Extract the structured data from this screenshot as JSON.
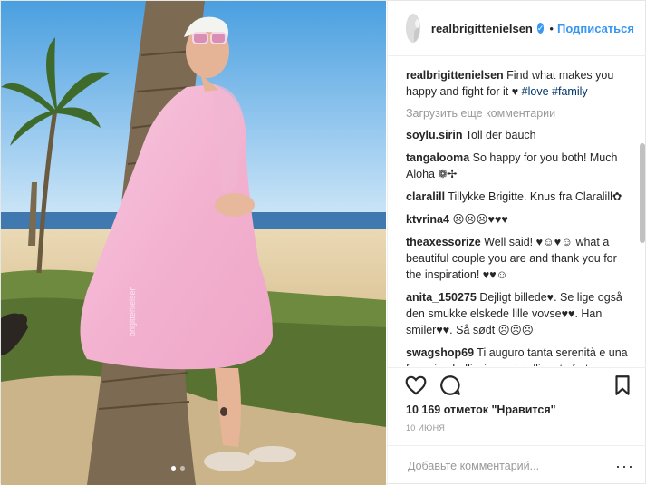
{
  "colors": {
    "link": "#3897f0",
    "hashtag": "#003569",
    "muted": "#999999",
    "text": "#262626"
  },
  "photo": {
    "watermark": "brigittenielsen",
    "carousel_dots": 2,
    "active_dot": 1
  },
  "header": {
    "username": "realbrigittenielsen",
    "verified_icon": "check-icon",
    "separator": "•",
    "follow_label": "Подписаться"
  },
  "caption": {
    "username": "realbrigittenielsen",
    "text": "Find what makes you happy and fight for it ♥",
    "hashtags": [
      "#love",
      "#family"
    ]
  },
  "load_more": "Загрузить еще комментарии",
  "comments": [
    {
      "user": "soylu.sirin",
      "text": "Toll der bauch"
    },
    {
      "user": "tangalooma",
      "text": "So happy for you both! Much Aloha ❁✢"
    },
    {
      "user": "claralill",
      "text": "Tillykke Brigitte. Knus fra Claralill✿"
    },
    {
      "user": "ktvrina4",
      "text": "☹☹☹♥♥♥"
    },
    {
      "user": "theaxessorize",
      "text": "Well said! ♥☺♥☺ what a beautiful couple you are and thank you for the inspiration! ♥♥☺"
    },
    {
      "user": "anita_150275",
      "text": "Dejligt billede♥. Se lige også den smukke elskede lille vovse♥♥. Han smiler♥♥. Så sødt ☹☹☹"
    },
    {
      "user": "swagshop69",
      "text": "Ti auguro tanta serenità e una femmina bellissima e intelligente forte come te,un bacio diva,te lo meriti"
    }
  ],
  "actions": {
    "like_icon": "heart-icon",
    "comment_icon": "comment-icon",
    "save_icon": "bookmark-icon"
  },
  "likes": "10 169 отметок \"Нравится\"",
  "date": "10 ИЮНЯ",
  "add_comment": {
    "placeholder": "Добавьте комментарий...",
    "more_icon": "ellipsis-icon",
    "more_label": "···"
  }
}
